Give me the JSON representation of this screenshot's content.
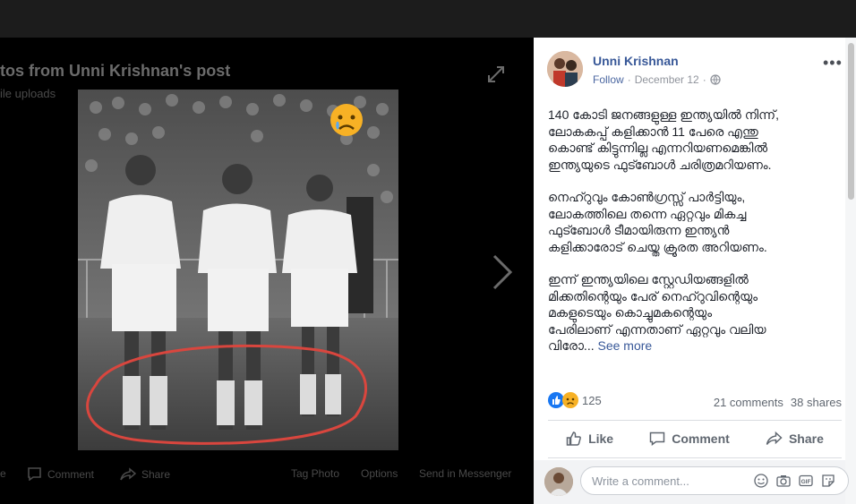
{
  "viewer": {
    "title": "tos from Unni Krishnan's post",
    "subtitle": "ile uploads",
    "bottom_bar": {
      "partial": "e",
      "comment": "Comment",
      "share": "Share",
      "tag_photo": "Tag Photo",
      "options": "Options",
      "send": "Send in Messenger"
    }
  },
  "post": {
    "author": "Unni Krishnan",
    "follow": "Follow",
    "separator": "·",
    "date": "December 12",
    "separator2": "·",
    "more_glyph": "•••",
    "paragraphs": [
      "140 കോടി ജനങ്ങളുള്ള ഇന്ത്യയിൽ നിന്ന്,\nലോകകപ്പ് കളിക്കാൻ 11 പേരെ എന്തു\nകൊണ്ട് കിട്ടുന്നില്ല എന്നറിയണമെങ്കിൽ\nഇന്ത്യയുടെ ഫുട്ബോൾ ചരിത്രമറിയണം.",
      "നെഹ്റുവും കോൺഗ്രസ്സ് പാർട്ടിയും,\nലോകത്തിലെ തന്നെ ഏറ്റവും മികച്ച\nഫുട്ബോൾ ടീമായിരുന്ന ഇന്ത്യൻ\nകളിക്കാരോട് ചെയ്ത ക്രൂരത അറിയണം."
    ],
    "last_paragraph": "ഇന്ന് ഇന്ത്യയിലെ സ്റ്റേഡിയങ്ങളിൽ\nമിക്കതിന്റെയും പേര് നെഹ്റുവിന്റെയും\nമകളുടെയും കൊച്ചുമകന്റെയും\nപേരിലാണ് എന്നതാണ് ഏറ്റവും വലിയ\nവിരോ...",
    "see_more": "See more",
    "reaction_count": "125",
    "comments_count": "21 comments",
    "shares_count": "38 shares",
    "actions": {
      "like": "Like",
      "comment": "Comment",
      "share": "Share"
    },
    "comment_placeholder": "Write a comment..."
  },
  "colors": {
    "link": "#385898",
    "like_blue": "#1877f2",
    "sad_yellow": "#f7b125",
    "annotation_red": "#d9463e"
  },
  "icons": [
    "expand-icon",
    "next-arrow-icon",
    "sad-emoji-icon",
    "globe-icon",
    "like-icon",
    "comment-icon",
    "share-icon",
    "emoji-icon",
    "camera-icon",
    "gif-icon",
    "sticker-icon"
  ]
}
